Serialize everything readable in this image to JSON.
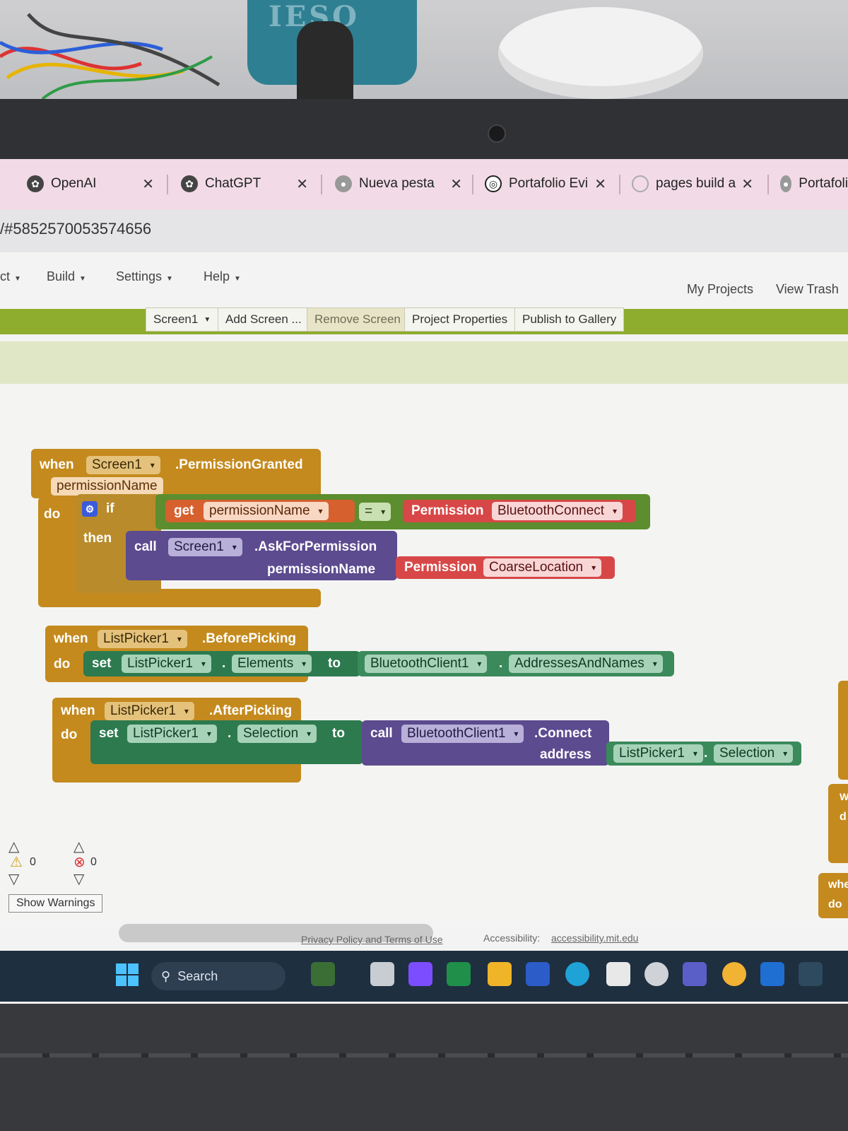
{
  "tabs": [
    {
      "label": "OpenAI",
      "icon": "openai-icon"
    },
    {
      "label": "ChatGPT",
      "icon": "openai-icon"
    },
    {
      "label": "Nueva pesta",
      "icon": "globe-icon"
    },
    {
      "label": "Portafolio Evi",
      "icon": "globe-icon"
    },
    {
      "label": "pages build a",
      "icon": "spinner-icon"
    },
    {
      "label": "Portafoli",
      "icon": "globe-icon"
    }
  ],
  "url": "/#5852570053574656",
  "menu": {
    "project": "ct",
    "build": "Build",
    "settings": "Settings",
    "help": "Help",
    "my_projects": "My Projects",
    "view_trash": "View Trash"
  },
  "toolbar": {
    "screen": "Screen1",
    "add_screen": "Add Screen ...",
    "remove_screen": "Remove Screen",
    "project_properties": "Project Properties",
    "publish": "Publish to Gallery"
  },
  "blocks": {
    "b1": {
      "when": "when",
      "component": "Screen1",
      "event": ".PermissionGranted",
      "param": "permissionName",
      "do": "do",
      "if": "if",
      "then": "then",
      "get": "get",
      "get_var": "permissionName",
      "op": "=",
      "perm_label": "Permission",
      "perm_value": "BluetoothConnect",
      "call": "call",
      "call_comp": "Screen1",
      "call_method": ".AskForPermission",
      "arg_label": "permissionName",
      "perm2_label": "Permission",
      "perm2_value": "CoarseLocation"
    },
    "b2": {
      "when": "when",
      "component": "ListPicker1",
      "event": ".BeforePicking",
      "do": "do",
      "set": "set",
      "set_comp": "ListPicker1",
      "dot": ".",
      "prop": "Elements",
      "to": "to",
      "src_comp": "BluetoothClient1",
      "src_dot": ".",
      "src_prop": "AddressesAndNames"
    },
    "b3": {
      "when": "when",
      "component": "ListPicker1",
      "event": ".AfterPicking",
      "do": "do",
      "set": "set",
      "set_comp": "ListPicker1",
      "dot": ".",
      "prop": "Selection",
      "to": "to",
      "call": "call",
      "call_comp": "BluetoothClient1",
      "call_method": ".Connect",
      "arg_label": "address",
      "arg_comp": "ListPicker1",
      "arg_dot": ".",
      "arg_prop": "Selection"
    },
    "partial": {
      "w": "W",
      "d": "d",
      "whe": "whe",
      "do": "do"
    }
  },
  "warnings": {
    "warning_count": "0",
    "error_count": "0",
    "show_label": "Show Warnings"
  },
  "footer": {
    "privacy": "Privacy Policy and Terms of Use",
    "accessibility_label": "Accessibility:",
    "accessibility_link": "accessibility.mit.edu"
  },
  "taskbar": {
    "search": "Search"
  },
  "colors": {
    "event": "#c48a1e",
    "component": "#5c4b8f",
    "setter": "#2d7a4f",
    "permission": "#d84747",
    "variable": "#d6602e",
    "toolbar": "#8eac2e"
  }
}
